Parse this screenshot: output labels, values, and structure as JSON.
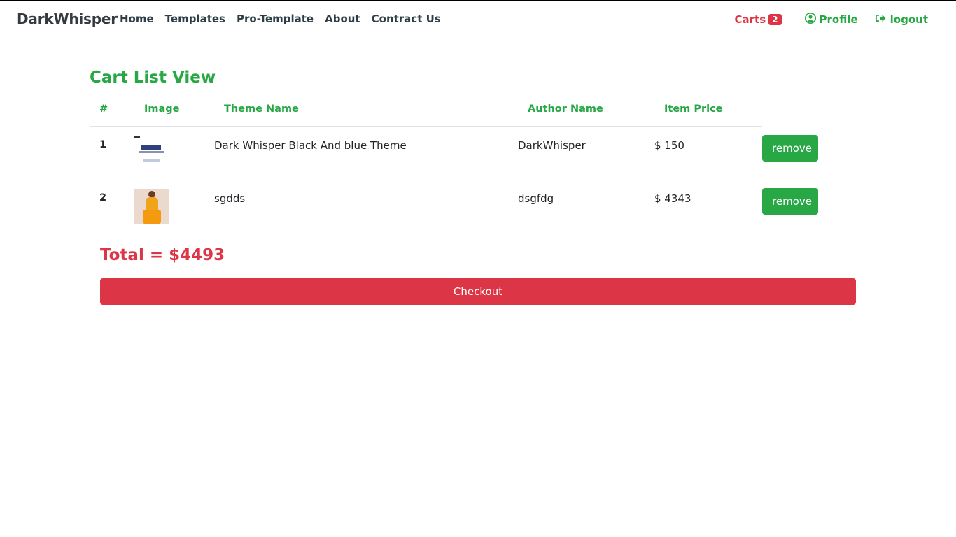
{
  "navbar": {
    "brand": "DarkWhisper",
    "links": [
      "Home",
      "Templates",
      "Pro-Template",
      "About",
      "Contract Us"
    ],
    "carts_label": "Carts",
    "carts_count": "2",
    "profile_label": "Profile",
    "logout_label": "logout"
  },
  "page": {
    "title": "Cart List View"
  },
  "table": {
    "headers": [
      "#",
      "Image",
      "Theme Name",
      "Author Name",
      "Item Price"
    ],
    "rows": [
      {
        "num": "1",
        "theme": "Dark Whisper Black And blue Theme",
        "author": "DarkWhisper",
        "price": "$ 150",
        "action": "remove"
      },
      {
        "num": "2",
        "theme": "sgdds",
        "author": "dsgfdg",
        "price": "$ 4343",
        "action": "remove"
      }
    ]
  },
  "summary": {
    "total": "Total = $4493",
    "checkout_label": "Checkout"
  },
  "colors": {
    "green": "#28a745",
    "red": "#dc3545",
    "dark": "#343a40"
  }
}
